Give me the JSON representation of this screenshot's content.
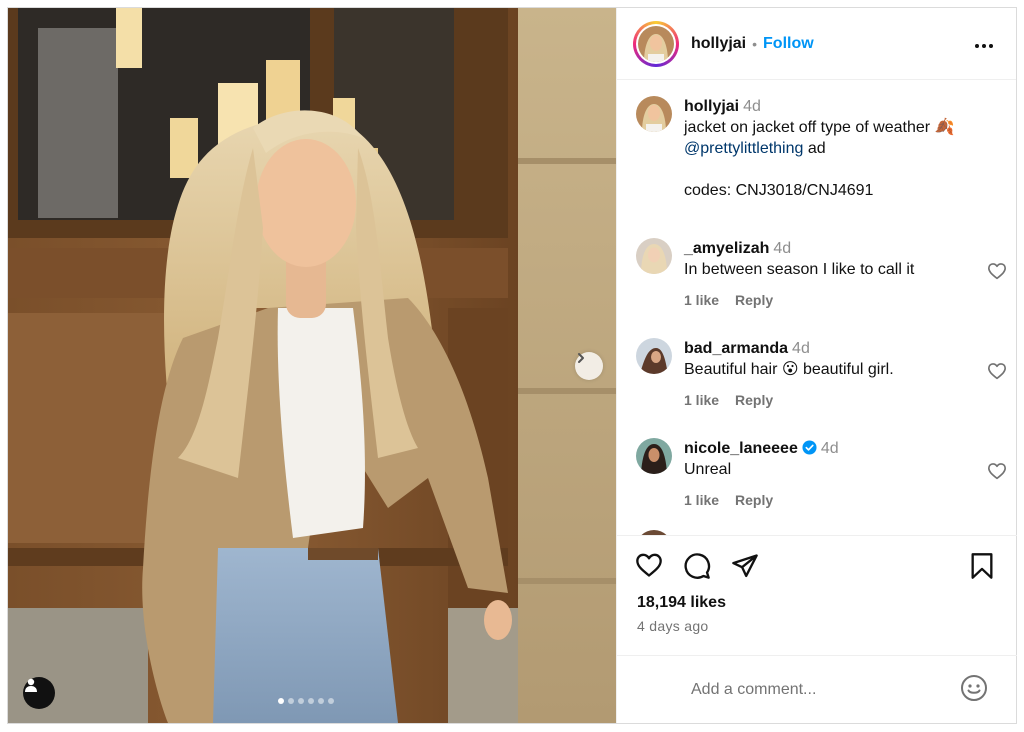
{
  "post": {
    "author": "hollyjai",
    "follow_label": "Follow",
    "separator": "•",
    "more_icon": "more-horizontal-icon",
    "carousel": {
      "total_slides": 6,
      "active_slide": 1
    }
  },
  "caption": {
    "user": "hollyjai",
    "time": "4d",
    "line1": "jacket on jacket off type of weather 🍂",
    "mention": "@prettylittlething",
    "after_mention": " ad",
    "codes": "codes: CNJ3018/CNJ4691"
  },
  "comments": [
    {
      "user": "_amyelizah",
      "time": "4d",
      "text": "In between season I like to call it",
      "likes": "1 like",
      "reply": "Reply",
      "verified": false
    },
    {
      "user": "bad_armanda",
      "time": "4d",
      "text": "Beautiful hair 😮 beautiful girl.",
      "likes": "1 like",
      "reply": "Reply",
      "verified": false
    },
    {
      "user": "nicole_laneeee",
      "time": "4d",
      "text": "Unreal",
      "likes": "1 like",
      "reply": "Reply",
      "verified": true
    }
  ],
  "stats": {
    "likes": "18,194 likes",
    "date": "4 days ago"
  },
  "composer": {
    "placeholder": "Add a comment..."
  },
  "colors": {
    "follow_blue": "#0095f6",
    "verified_blue": "#0095f6",
    "mention_blue": "#00376b",
    "muted": "#737373"
  }
}
